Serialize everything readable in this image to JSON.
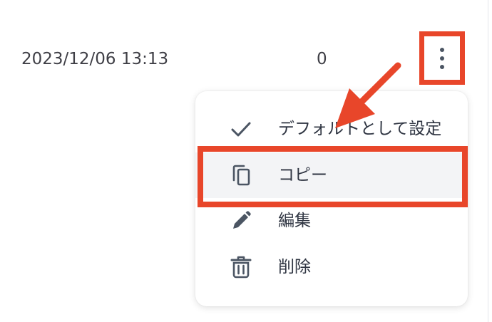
{
  "row": {
    "date": "2023/12/06 13:13",
    "count": "0"
  },
  "kebab": {
    "icon": "more-vertical-icon"
  },
  "menu": {
    "items": [
      {
        "label": "デフォルトとして設定",
        "icon": "check-icon"
      },
      {
        "label": "コピー",
        "icon": "copy-icon"
      },
      {
        "label": "編集",
        "icon": "pencil-icon"
      },
      {
        "label": "削除",
        "icon": "trash-icon"
      }
    ]
  },
  "annotation": {
    "color": "#e8462a"
  }
}
